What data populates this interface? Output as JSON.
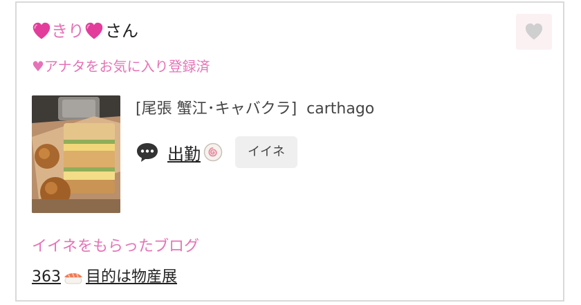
{
  "user": {
    "name": "きり",
    "suffix": "さん",
    "heart_emoji": "pink-heart-emoji"
  },
  "favorite_status": "♥アナタをお気に入り登録済",
  "favorite_button": {
    "icon": "heart-icon",
    "color": "#cfcfcf"
  },
  "post": {
    "shop_area": "[尾張 蟹江･キャバクラ]",
    "shop_name": "carthago",
    "title": "出勤",
    "title_emoji": "narutomaki-emoji",
    "comment_icon": "speech-bubble-icon",
    "like_label": "イイネ"
  },
  "blog_section": {
    "heading": "イイネをもらったブログ",
    "link_number": "363",
    "link_emoji": "sushi-emoji",
    "link_text": "目的は物産展"
  },
  "colors": {
    "accent_pink": "#e573b7",
    "fav_button_bg": "#fbf1f3",
    "like_button_bg": "#efefef",
    "border": "#d9d9d9"
  }
}
